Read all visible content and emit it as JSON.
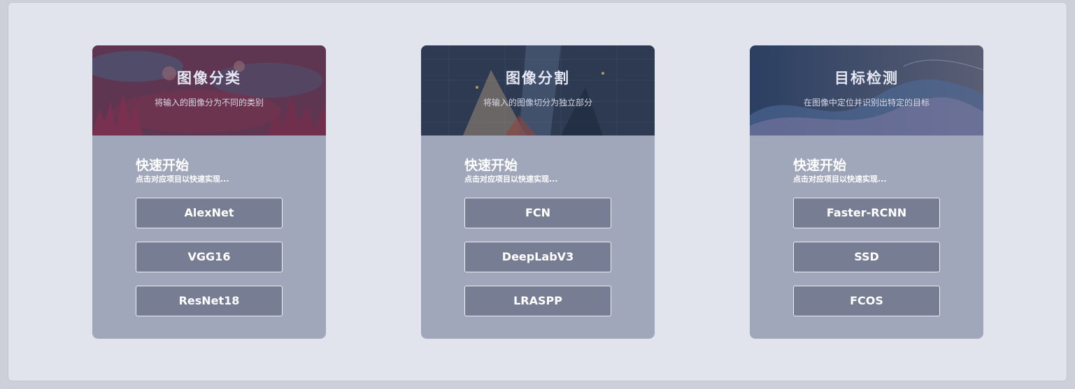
{
  "cards": [
    {
      "title": "图像分类",
      "subtitle": "将输入的图像分为不同的类别",
      "quickstart_title": "快速开始",
      "quickstart_sub": "点击对应项目以快速实现...",
      "models": [
        "AlexNet",
        "VGG16",
        "ResNet18"
      ]
    },
    {
      "title": "图像分割",
      "subtitle": "将输入的图像切分为独立部分",
      "quickstart_title": "快速开始",
      "quickstart_sub": "点击对应项目以快速实现...",
      "models": [
        "FCN",
        "DeepLabV3",
        "LRASPP"
      ]
    },
    {
      "title": "目标检测",
      "subtitle": "在图像中定位并识别出特定的目标",
      "quickstart_title": "快速开始",
      "quickstart_sub": "点击对应项目以快速实现...",
      "models": [
        "Faster-RCNN",
        "SSD",
        "FCOS"
      ]
    }
  ],
  "colors": {
    "page_bg": "#e1e4ed",
    "card_bg": "#a1a7ba",
    "button_bg": "#777e93",
    "button_border": "#eef0f6"
  }
}
